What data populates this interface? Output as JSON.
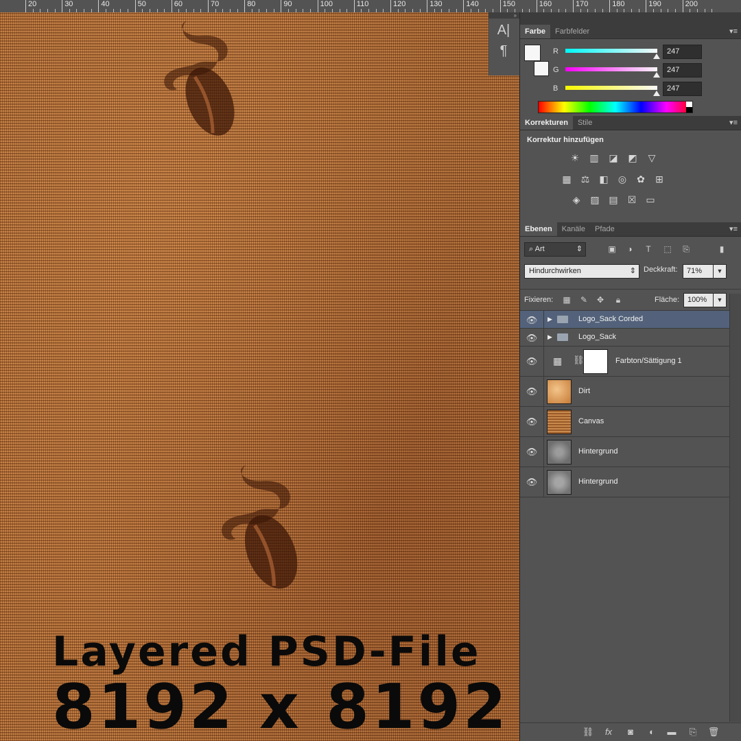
{
  "ruler": {
    "labels": [
      "20",
      "30",
      "40",
      "50",
      "60",
      "70",
      "80",
      "90",
      "100",
      "110",
      "120",
      "130",
      "140",
      "150",
      "160",
      "170",
      "180",
      "190",
      "200"
    ]
  },
  "canvas": {
    "promo_line1": "Layered PSD-File",
    "promo_line2": "8192 x 8192"
  },
  "tools": {
    "icons": [
      "character-icon",
      "paragraph-icon"
    ]
  },
  "color_panel": {
    "tabs": [
      "Farbe",
      "Farbfelder"
    ],
    "r_label": "R",
    "g_label": "G",
    "b_label": "B",
    "r": "247",
    "g": "247",
    "b": "247",
    "foreground": "#f7f7f7",
    "background": "#f7f7f7"
  },
  "adjustments_panel": {
    "tabs": [
      "Korrekturen",
      "Stile"
    ],
    "heading": "Korrektur hinzufügen"
  },
  "layers_panel": {
    "tabs": [
      "Ebenen",
      "Kanäle",
      "Pfade"
    ],
    "filter_kind": "Art",
    "blend_mode": "Hindurchwirken",
    "opacity_label": "Deckkraft:",
    "opacity": "71%",
    "lock_label": "Fixieren:",
    "fill_label": "Fläche:",
    "fill": "100%",
    "layers": [
      {
        "name": "Logo_Sack Corded",
        "type": "group",
        "selected": true
      },
      {
        "name": "Logo_Sack",
        "type": "group"
      },
      {
        "name": "Farbton/Sättigung 1",
        "type": "adjustment"
      },
      {
        "name": "Dirt",
        "type": "pixel"
      },
      {
        "name": "Canvas",
        "type": "pixel"
      },
      {
        "name": "Hintergrund",
        "type": "pixel"
      },
      {
        "name": "Hintergrund",
        "type": "pixel"
      }
    ]
  }
}
